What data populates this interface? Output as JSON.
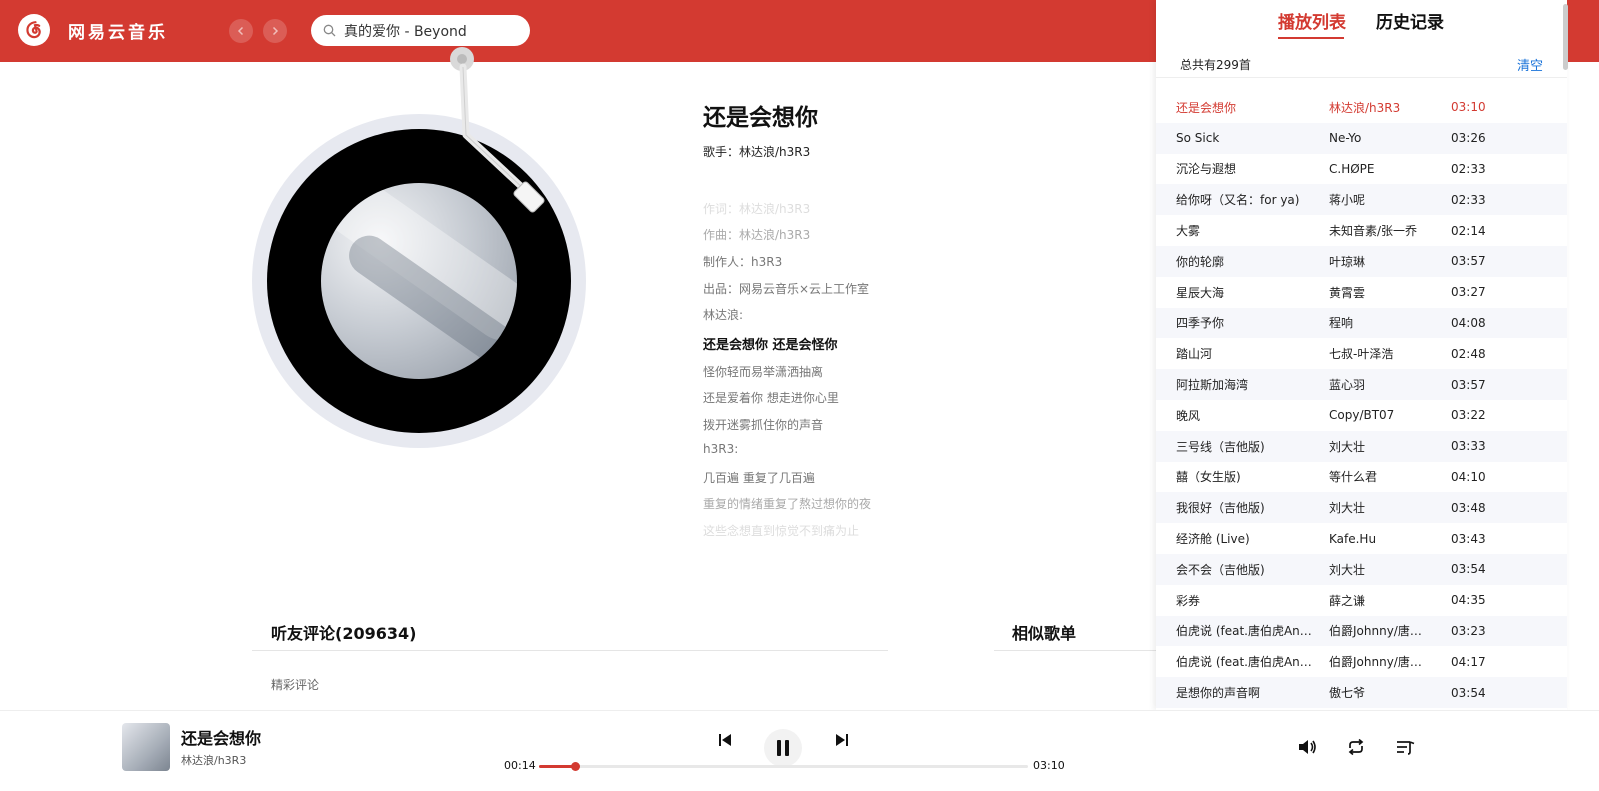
{
  "header": {
    "app_name": "网易云音乐",
    "search_value": "真的爱你 - Beyond"
  },
  "song": {
    "title": "还是会想你",
    "singer_label": "歌手：林达浪/h3R3"
  },
  "lyrics": [
    {
      "text": "作词：林达浪/h3R3",
      "style": "faded"
    },
    {
      "text": "作曲：林达浪/h3R3",
      "style": "light"
    },
    {
      "text": "制作人：h3R3",
      "style": "normal"
    },
    {
      "text": "出品：网易云音乐×云上工作室",
      "style": "normal"
    },
    {
      "text": "林达浪:",
      "style": "normal"
    },
    {
      "text": "还是会想你 还是会怪你",
      "style": "current"
    },
    {
      "text": "怪你轻而易举潇洒抽离",
      "style": "normal"
    },
    {
      "text": "还是爱着你 想走进你心里",
      "style": "normal"
    },
    {
      "text": "拨开迷雾抓住你的声音",
      "style": "normal"
    },
    {
      "text": "h3R3:",
      "style": "normal"
    },
    {
      "text": "几百遍 重复了几百遍",
      "style": "normal"
    },
    {
      "text": "重复的情绪重复了熬过想你的夜",
      "style": "light"
    },
    {
      "text": "这些念想直到惊觉不到痛为止",
      "style": "faded"
    }
  ],
  "comments": {
    "title": "听友评论(209634)",
    "subtitle": "精彩评论"
  },
  "similar": {
    "title": "相似歌单"
  },
  "playlist_panel": {
    "tab_playlist": "播放列表",
    "tab_history": "历史记录",
    "count_label": "总共有299首",
    "clear_label": "清空",
    "rows": [
      {
        "name": "还是会想你",
        "artist": "林达浪/h3R3",
        "time": "03:10"
      },
      {
        "name": "So Sick",
        "artist": "Ne-Yo",
        "time": "03:26"
      },
      {
        "name": "沉沦与遐想",
        "artist": "C.HØPE",
        "time": "02:33"
      },
      {
        "name": "给你呀（又名：for ya)",
        "artist": "蒋小呢",
        "time": "02:33"
      },
      {
        "name": "大雾",
        "artist": "未知音素/张一乔",
        "time": "02:14"
      },
      {
        "name": "你的轮廓",
        "artist": "叶琼琳",
        "time": "03:57"
      },
      {
        "name": "星辰大海",
        "artist": "黄霄雲",
        "time": "03:27"
      },
      {
        "name": "四季予你",
        "artist": "程响",
        "time": "04:08"
      },
      {
        "name": "踏山河",
        "artist": "七叔-叶泽浩",
        "time": "02:48"
      },
      {
        "name": "阿拉斯加海湾",
        "artist": "蓝心羽",
        "time": "03:57"
      },
      {
        "name": "晚风",
        "artist": "Copy/BT07",
        "time": "03:22"
      },
      {
        "name": "三号线（吉他版)",
        "artist": "刘大壮",
        "time": "03:33"
      },
      {
        "name": "囍（女生版)",
        "artist": "等什么君",
        "time": "04:10"
      },
      {
        "name": "我很好（吉他版)",
        "artist": "刘大壮",
        "time": "03:48"
      },
      {
        "name": "经济舱 (Live)",
        "artist": "Kafe.Hu",
        "time": "03:43"
      },
      {
        "name": "会不会（吉他版)",
        "artist": "刘大壮",
        "time": "03:54"
      },
      {
        "name": "彩券",
        "artist": "薛之谦",
        "time": "04:35"
      },
      {
        "name": "伯虎说 (feat.唐伯虎An…",
        "artist": "伯爵Johnny/唐…",
        "time": "03:23"
      },
      {
        "name": "伯虎说 (feat.唐伯虎An…",
        "artist": "伯爵Johnny/唐…",
        "time": "04:17"
      },
      {
        "name": "是想你的声音啊",
        "artist": "傲七爷",
        "time": "03:54"
      }
    ]
  },
  "player": {
    "title": "还是会想你",
    "artist": "林达浪/h3R3",
    "current_time": "00:14",
    "total_time": "03:10",
    "progress": 0.074
  },
  "colors": {
    "brand": "#d33a31",
    "link": "#1a73d9"
  }
}
